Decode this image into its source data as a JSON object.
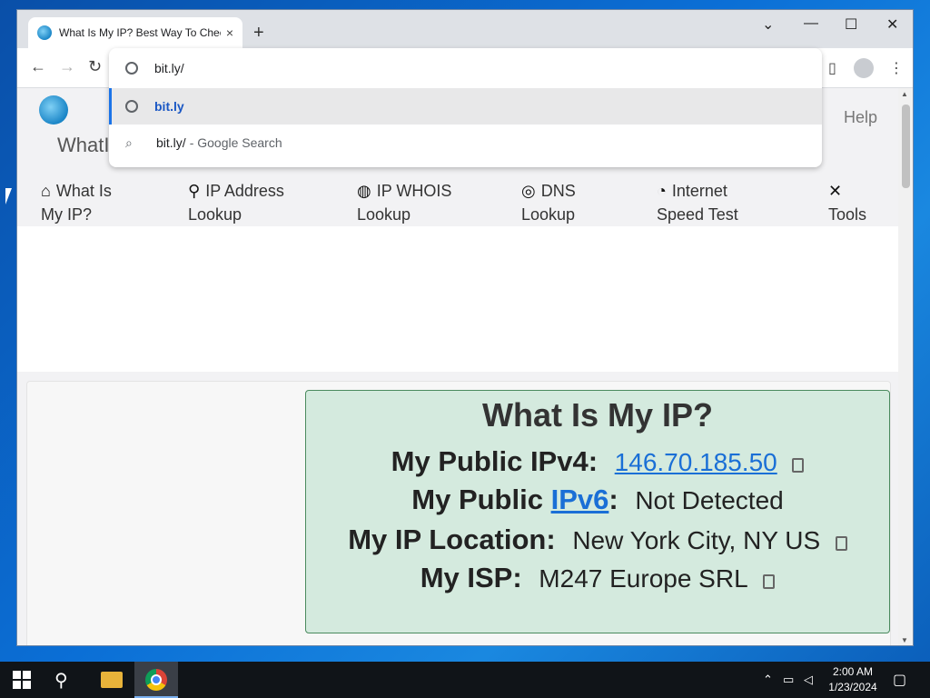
{
  "browser": {
    "tab_title": "What Is My IP? Best Way To Chec",
    "new_tab": "+",
    "tab_close": "×",
    "address_input": "bit.ly/",
    "window_controls": {
      "dropdown": "⌄",
      "minimize": "—",
      "maximize": "☐",
      "close": "✕"
    },
    "suggestions": [
      {
        "main": "bit.ly",
        "sub": "",
        "icon": "globe-icon"
      },
      {
        "main": "bit.ly/",
        "sub": "- Google Search",
        "icon": "search-icon"
      }
    ]
  },
  "site": {
    "name_partial": "WhatI",
    "help": "Help",
    "nav": [
      {
        "icon": "home-icon",
        "glyph": "⌂",
        "line1": "What Is",
        "line2": "My IP?"
      },
      {
        "icon": "location-pin-icon",
        "glyph": "⚲",
        "line1": "IP Address",
        "line2": "Lookup"
      },
      {
        "icon": "globe-icon",
        "glyph": "◍",
        "line1": "IP WHOIS",
        "line2": "Lookup"
      },
      {
        "icon": "dns-icon",
        "glyph": "◎",
        "line1": "DNS",
        "line2": "Lookup"
      },
      {
        "icon": "speedometer-icon",
        "glyph": "◔",
        "line1": "Internet",
        "line2": "Speed Test"
      },
      {
        "icon": "tools-icon",
        "glyph": "✕",
        "line1": "",
        "line2": "Tools"
      }
    ]
  },
  "ip_card": {
    "heading": "What Is My IP?",
    "ipv4_label": "My Public IPv4:",
    "ipv4_value": "146.70.185.50",
    "ipv6_label_pre": "My Public ",
    "ipv6_label_link": "IPv6",
    "ipv6_label_post": ":",
    "ipv6_value": "Not Detected",
    "location_label": "My IP Location:",
    "location_value": "New York City, NY US",
    "isp_label": "My ISP:",
    "isp_value": "M247 Europe SRL"
  },
  "taskbar": {
    "time": "2:00 AM",
    "date": "1/23/2024"
  }
}
